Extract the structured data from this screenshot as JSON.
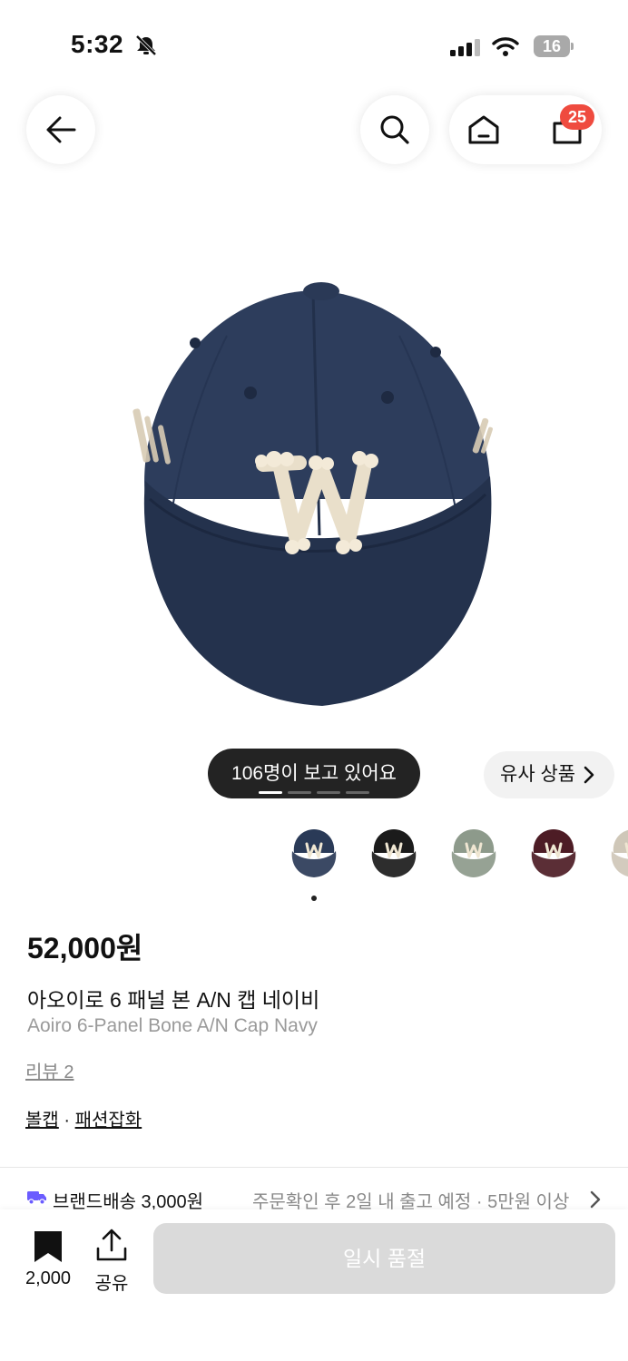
{
  "status_bar": {
    "time": "5:32",
    "battery": "16"
  },
  "nav": {
    "cart_count": "25"
  },
  "gallery": {
    "viewers": "106명이 보고 있어요",
    "similar_label": "유사 상품",
    "active_index": 0,
    "thumbnails": [
      {
        "color": "#2a3a57",
        "label": "navy"
      },
      {
        "color": "#1b1b1b",
        "label": "black"
      },
      {
        "color": "#8d9a8b",
        "label": "sage"
      },
      {
        "color": "#4d1c25",
        "label": "burgundy"
      },
      {
        "color": "#cfc7b8",
        "label": "beige"
      }
    ]
  },
  "product": {
    "price": "52,000원",
    "name_ko": "아오이로 6 패널 본 A/N 캡 네이비",
    "name_en": "Aoiro 6-Panel Bone A/N Cap Navy",
    "review": "리뷰 2",
    "category_1": "볼캡",
    "category_sep": " · ",
    "category_2": "패션잡화"
  },
  "shipping": {
    "label": "브랜드배송 3,000원",
    "detail": "주문확인 후 2일 내 출고 예정 · 5만원 이상"
  },
  "bottom_bar": {
    "bookmark_count": "2,000",
    "share_label": "공유",
    "cta_label": "일시 품절"
  },
  "colors": {
    "accent": "#ef4b3f",
    "shipping_icon": "#6b5cff",
    "cap_navy": "#2a3a57"
  }
}
